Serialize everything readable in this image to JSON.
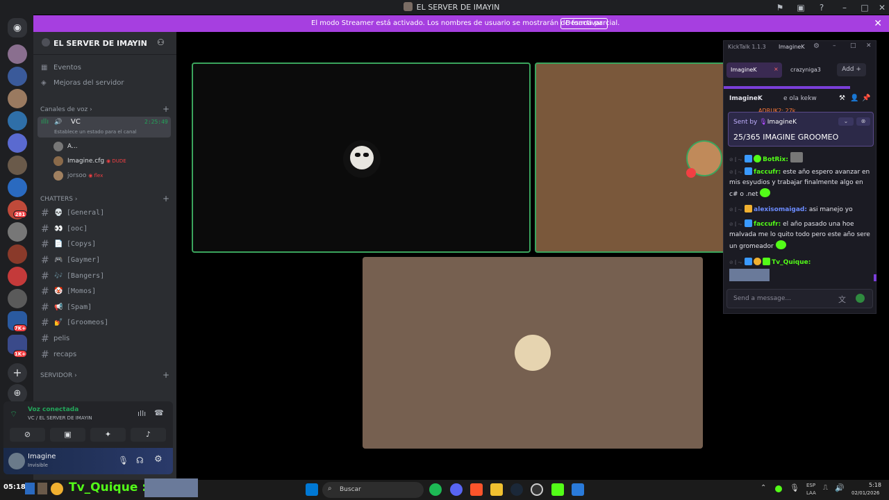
{
  "window": {
    "title": "EL SERVER DE IMAYIN"
  },
  "banner": {
    "text": "El modo Streamer está activado. Los nombres de usuario se mostrarán de forma parcial.",
    "button": "Desactivar"
  },
  "server_rail": {
    "badges": [
      "281",
      "7K+",
      "1K+"
    ]
  },
  "server": {
    "name": "EL SERVER DE IMAYIN",
    "top_items": [
      {
        "label": "Eventos",
        "icon": "calendar-icon"
      },
      {
        "label": "Mejoras del servidor",
        "icon": "boost-icon"
      }
    ],
    "voice_category": "Canales de voz",
    "voice_channel": {
      "name": "VC",
      "timer": "2:25:49",
      "status_hint": "Establece un estado para el canal"
    },
    "voice_users": [
      {
        "name": "A...",
        "tag": ""
      },
      {
        "name": "Imagine.cfg",
        "tag": "DUDE"
      },
      {
        "name": "jorsoo",
        "tag": "flex"
      }
    ],
    "chatters_category": "CHATTERS",
    "text_channels": [
      {
        "emoji": "💀",
        "label": "[General]"
      },
      {
        "emoji": "👀",
        "label": "[ooc]"
      },
      {
        "emoji": "📄",
        "label": "[Copys]"
      },
      {
        "emoji": "🎮",
        "label": "[Gaymer]"
      },
      {
        "emoji": "🎶",
        "label": "[Bangers]"
      },
      {
        "emoji": "🤡",
        "label": "[Momos]"
      },
      {
        "emoji": "📢",
        "label": "[Spam]"
      },
      {
        "emoji": "💅",
        "label": "[Groomeos]"
      },
      {
        "emoji": "",
        "label": "pelis"
      },
      {
        "emoji": "",
        "label": "recaps"
      }
    ],
    "servidor_category": "SERVIDOR"
  },
  "voice_panel": {
    "status": "Voz conectada",
    "location": "VC / EL SERVER DE IMAYIN"
  },
  "user_panel": {
    "name": "Imagine",
    "status": "Invisible"
  },
  "kicktalk": {
    "app_title": "KickTalk 1.1.3",
    "account": "ImagineK",
    "tabs": [
      "ImagineK",
      "crazyniga3"
    ],
    "add_label": "Add",
    "channel": "ImagineK",
    "last_message_preview": "e ola kekw",
    "partial_top": "ADRUK2: 27k",
    "pinned": {
      "sent_by_label": "Sent by",
      "sender": "ImagineK",
      "text": "25/365 IMAGINE GROOMEO"
    },
    "messages": [
      {
        "user": "BotRix:",
        "text": "",
        "color": "#53fc18"
      },
      {
        "user": "faccufr:",
        "text": "este año espero avanzar en mis esyudios y trabajar finalmente algo en c# o .net",
        "color": "#53fc18"
      },
      {
        "user": "alexisomaigad:",
        "text": "asi manejo yo",
        "color": "#6c8cff"
      },
      {
        "user": "faccufr:",
        "text": "el año pasado una hoe malvada me lo quito todo pero este año sere un gromeador",
        "color": "#53fc18"
      },
      {
        "user": "Tv_Quique:",
        "text": "",
        "color": "#53fc18"
      }
    ],
    "input_placeholder": "Send a message...",
    "colors": {
      "accent": "#9b4dff",
      "kick_green": "#53fc18"
    }
  },
  "overlay": {
    "user": "Tv_Quique :"
  },
  "taskbar": {
    "search": "Buscar",
    "lang_top": "ESP",
    "lang_bottom": "LAA",
    "time": "5:18",
    "date": "02/01/2026",
    "left_time": "05:18"
  },
  "colors": {
    "streamer_banner": "#a63fe0",
    "speaking_border": "#3ba55d"
  }
}
